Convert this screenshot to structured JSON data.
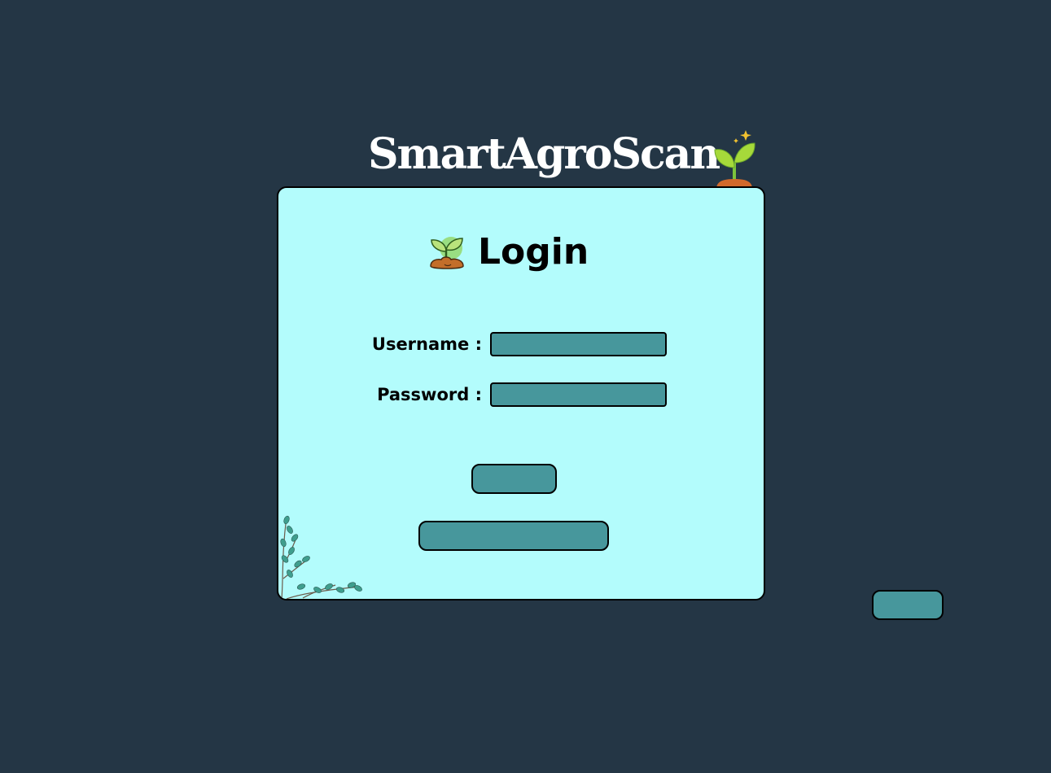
{
  "header": {
    "app_title": "SmartAgroScan"
  },
  "login_card": {
    "title": "Login",
    "username_label": "Username :",
    "password_label": "Password :",
    "username_value": "",
    "password_value": "",
    "login_button_label": "",
    "secondary_button_label": ""
  },
  "outside_button_label": "",
  "icons": {
    "header": "sprout-icon",
    "login": "seedling-soil-icon",
    "corner": "branch-decoration-icon"
  },
  "colors": {
    "background": "#243645",
    "card": "#b3fcfc",
    "input": "#47979c",
    "button": "#47979c",
    "title_text": "#ffffff"
  }
}
